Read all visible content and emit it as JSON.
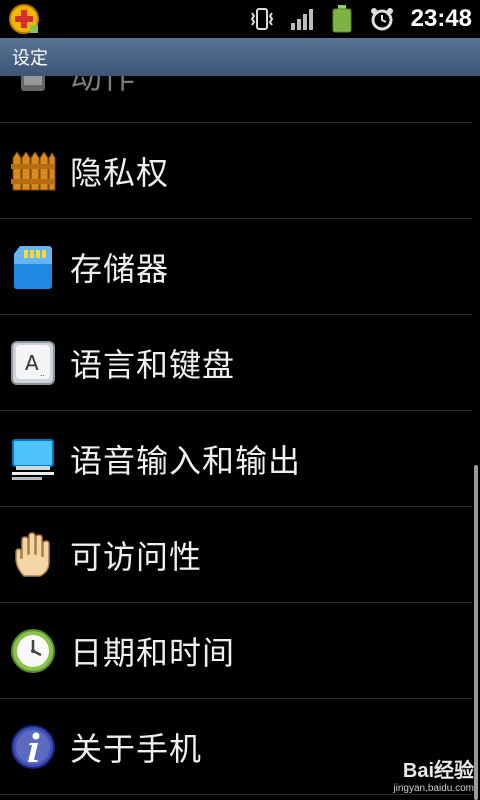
{
  "status_bar": {
    "time": "23:48",
    "icons": [
      "app-notification-icon",
      "vibrate-icon",
      "signal-icon",
      "battery-icon",
      "alarm-icon"
    ]
  },
  "header": {
    "title": "设定"
  },
  "settings": {
    "items": [
      {
        "label": "动作",
        "icon": "motion-icon"
      },
      {
        "label": "隐私权",
        "icon": "fence-icon"
      },
      {
        "label": "存储器",
        "icon": "sd-card-icon"
      },
      {
        "label": "语言和键盘",
        "icon": "keyboard-key-icon"
      },
      {
        "label": "语音输入和输出",
        "icon": "voice-monitor-icon"
      },
      {
        "label": "可访问性",
        "icon": "hand-icon"
      },
      {
        "label": "日期和时间",
        "icon": "clock-icon"
      },
      {
        "label": "关于手机",
        "icon": "info-icon"
      }
    ]
  },
  "watermark": {
    "main": "Bai经验",
    "sub": "jingyan.baidu.com"
  },
  "colors": {
    "title_bar": "#4c6586",
    "background": "#000000",
    "divider": "#2b2b2b"
  }
}
